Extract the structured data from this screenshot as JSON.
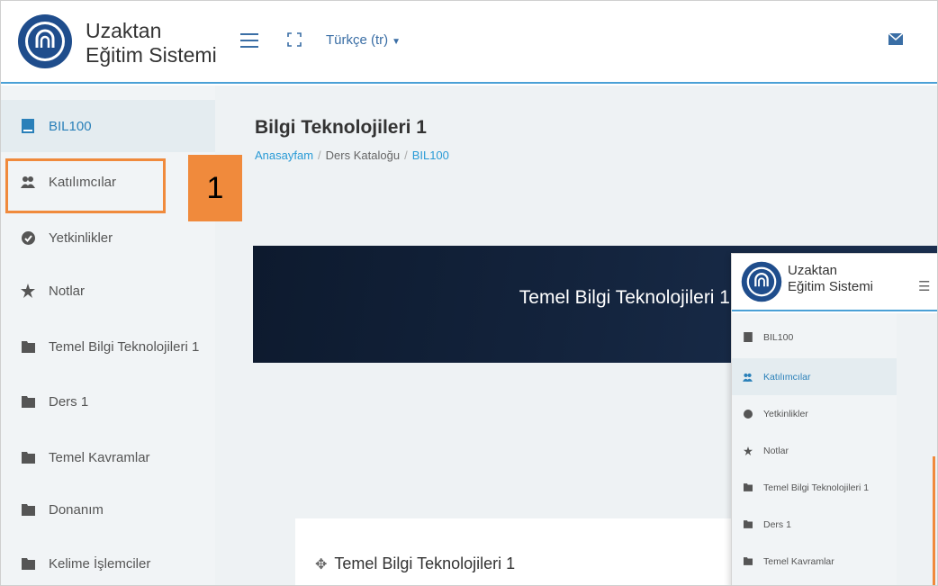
{
  "header": {
    "brand_line1": "Uzaktan",
    "brand_line2": "Eğitim Sistemi",
    "language": "Türkçe (tr)",
    "icons": [
      "university-logo",
      "hamburger-icon",
      "fullscreen-icon",
      "caret-down-icon",
      "mail-icon"
    ]
  },
  "sidebar": {
    "items": [
      {
        "label": "BIL100",
        "icon": "book-icon",
        "active": true
      },
      {
        "label": "Katılımcılar",
        "icon": "users-icon",
        "active": false
      },
      {
        "label": "Yetkinlikler",
        "icon": "check-circle-icon",
        "active": false
      },
      {
        "label": "Notlar",
        "icon": "star-icon",
        "active": false
      },
      {
        "label": "Temel Bilgi Teknolojileri 1",
        "icon": "folder-icon",
        "active": false
      },
      {
        "label": "Ders 1",
        "icon": "folder-icon",
        "active": false
      },
      {
        "label": "Temel Kavramlar",
        "icon": "folder-icon",
        "active": false
      },
      {
        "label": "Donanım",
        "icon": "folder-icon",
        "active": false
      },
      {
        "label": "Kelime İşlemciler",
        "icon": "folder-icon",
        "active": false
      }
    ]
  },
  "callout": {
    "number": "1"
  },
  "main": {
    "title": "Bilgi Teknolojileri 1",
    "breadcrumb": [
      "Anasayfam",
      "Ders Kataloğu",
      "BIL100"
    ],
    "banner_title": "Temel Bilgi Teknolojileri 1",
    "section_title": "Temel Bilgi Teknolojileri 1"
  },
  "inset": {
    "brand_line1": "Uzaktan",
    "brand_line2": "Eğitim Sistemi",
    "items": [
      {
        "label": "BIL100",
        "active": false
      },
      {
        "label": "Katılımcılar",
        "active": true
      },
      {
        "label": "Yetkinlikler",
        "active": false
      },
      {
        "label": "Notlar",
        "active": false
      },
      {
        "label": "Temel Bilgi Teknolojileri 1",
        "active": false
      },
      {
        "label": "Ders 1",
        "active": false
      },
      {
        "label": "Temel Kavramlar",
        "active": false
      }
    ]
  },
  "colors": {
    "accent": "#2a80b9",
    "link": "#2a9bd6",
    "highlight": "#f08a3c",
    "banner": "#0d1a2e"
  }
}
